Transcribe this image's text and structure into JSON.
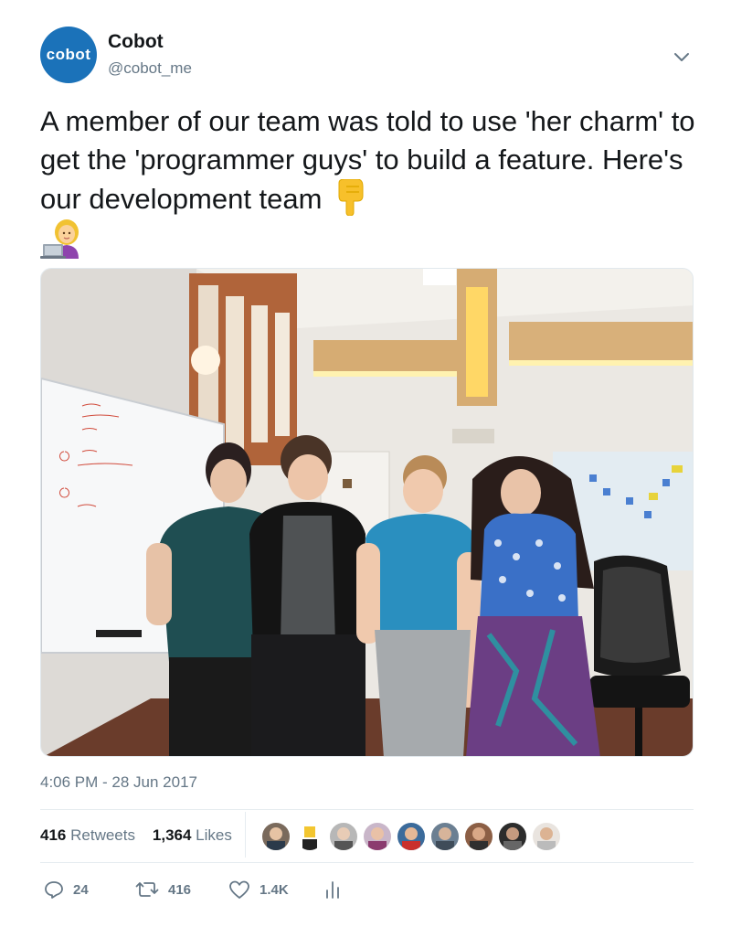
{
  "account": {
    "avatar_text": "cobot",
    "avatar_color": "#1b72b9",
    "name": "Cobot",
    "handle": "@cobot_me"
  },
  "tweet": {
    "text": "A member of our team was told to use 'her charm' to get the 'programmer guys' to build a feature. Here's our development team",
    "emoji_pointing": "backhand-index-pointing-down-icon",
    "emoji_technologist": "woman-technologist-icon"
  },
  "meta": {
    "timestamp": "4:06 PM - 28 Jun 2017"
  },
  "stats": {
    "retweets_count": "416",
    "retweets_label": "Retweets",
    "likes_count": "1,364",
    "likes_label": "Likes"
  },
  "actions": {
    "reply_count": "24",
    "retweet_count": "416",
    "like_count": "1.4K"
  },
  "colors": {
    "text_primary": "#14171a",
    "text_secondary": "#657786",
    "divider": "#e6ecf0"
  }
}
